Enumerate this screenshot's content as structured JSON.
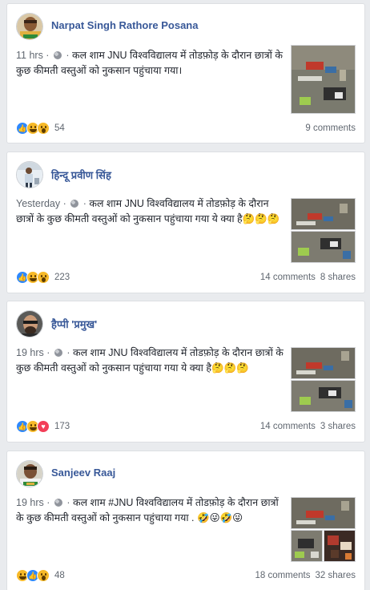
{
  "posts": [
    {
      "name": "Narpat Singh Rathore Posana",
      "time": "11 hrs",
      "text": "कल शाम JNU विश्वविद्यालय में तोडफ़ोड़ के दौरान छात्रों के कुछ कीमती वस्तुओं को नुकसान पहुंचाया गया।",
      "reactions": [
        "like-icon",
        "haha-icon",
        "wow-icon"
      ],
      "reaction_count": "54",
      "comments": "9 comments",
      "shares": ""
    },
    {
      "name": "हिन्दू प्रवीण सिंह",
      "time": "Yesterday",
      "text": "कल शाम JNU विश्वविद्यालय में तोडफ़ोड़ के दौरान छात्रों के कुछ कीमती वस्तुओं को नुकसान पहुंचाया गया ये क्या है🤔🤔🤔",
      "reactions": [
        "like-icon",
        "haha-icon",
        "wow-icon"
      ],
      "reaction_count": "223",
      "comments": "14 comments",
      "shares": "8 shares"
    },
    {
      "name": "हैप्पी 'प्रमुख'",
      "time": "19 hrs",
      "text": "कल शाम JNU विश्वविद्यालय में तोडफ़ोड़ के दौरान छात्रों के कुछ कीमती वस्तुओं को नुकसान पहुंचाया गया ये क्या है🤔🤔🤔",
      "reactions": [
        "like-icon",
        "haha-icon",
        "love-icon"
      ],
      "reaction_count": "173",
      "comments": "14 comments",
      "shares": "3 shares"
    },
    {
      "name": "Sanjeev Raaj",
      "time": "19 hrs",
      "text": "कल शाम #JNU विश्वविद्यालय में तोडफ़ोड़ के दौरान छात्रों के कुछ कीमती वस्तुओं को नुकसान पहुंचाया गया . 🤣😜🤣😜",
      "reactions": [
        "haha-icon",
        "like-icon",
        "wow-icon"
      ],
      "reaction_count": "48",
      "comments": "18 comments",
      "shares": "32 shares"
    }
  ],
  "colors": {
    "background": "#e9ebee",
    "name_link": "#385898",
    "meta": "#606770",
    "like": "#2d88ff",
    "haha": "#f7b928",
    "love": "#f33e58"
  }
}
